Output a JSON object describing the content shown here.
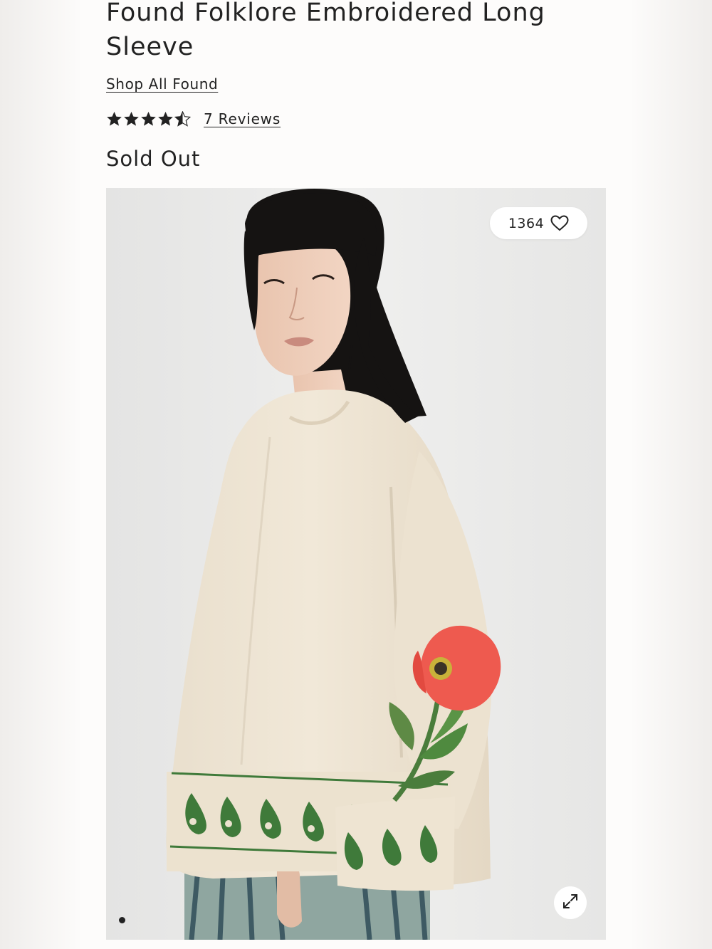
{
  "product": {
    "title": "Found Folklore Embroidered Long Sleeve",
    "shop_link": "Shop All Found",
    "rating": 4.5,
    "reviews_link": "7 Reviews",
    "availability": "Sold Out"
  },
  "gallery": {
    "like_count": "1364",
    "active_slide": 1,
    "slide_count": 1,
    "icons": {
      "like": "heart-icon",
      "expand": "expand-icon"
    }
  },
  "colors": {
    "text": "#222222",
    "sweater": "#efe6d6",
    "embroidery_green": "#3f7a3a",
    "poppy_red": "#ee5a4f",
    "photo_background": "#e9e9e8"
  }
}
